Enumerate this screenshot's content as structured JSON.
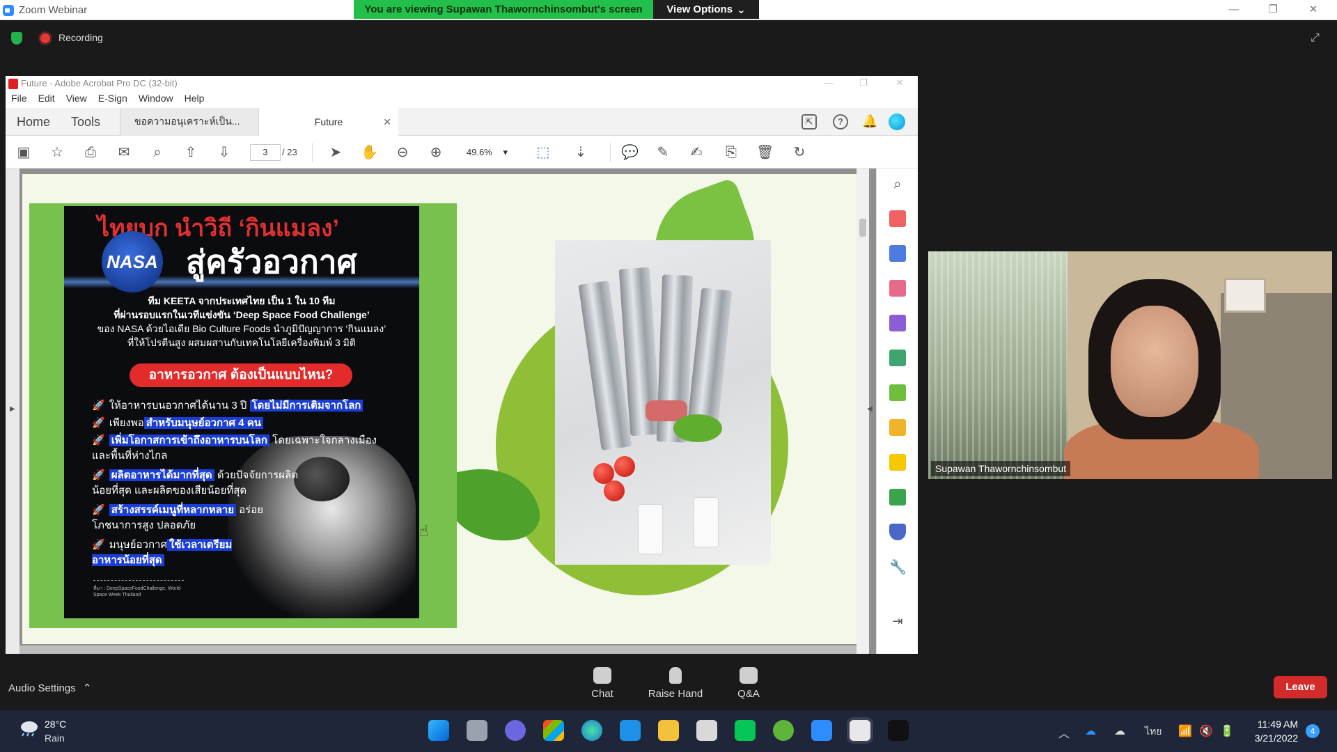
{
  "zoom": {
    "app_title": "Zoom Webinar",
    "share_banner": "You are viewing Supawan Thawornchinsombut's screen",
    "view_options": "View Options",
    "recording_label": "Recording"
  },
  "acrobat": {
    "title": "Future - Adobe Acrobat Pro DC (32-bit)",
    "menu": [
      "File",
      "Edit",
      "View",
      "E-Sign",
      "Window",
      "Help"
    ],
    "tab_home": "Home",
    "tab_tools": "Tools",
    "doc_tabs": [
      "ขอความอนุเคราะห์เป็น...",
      "Future"
    ],
    "page_current": "3",
    "page_total": "/ 23",
    "zoom_level": "49.6%"
  },
  "poster": {
    "headline_1": "ไทยบุก นำวิถี ‘กินแมลง’",
    "nasa": "NASA",
    "headline_2": "สู่ครัวอวกาศ",
    "intro": [
      "ทีม KEETA จากประเทศไทย เป็น 1 ใน 10 ทีม",
      "ที่ผ่านรอบแรกในเวทีแข่งขัน ‘Deep Space Food Challenge’",
      "ของ NASA ด้วยไอเดีย Bio Culture Foods นำภูมิปัญญาการ ‘กินแมลง’",
      "ที่ให้โปรตีนสูง ผสมผสานกับเทคโนโลยีเครื่องพิมพ์ 3 มิติ"
    ],
    "pill": "อาหารอวกาศ ต้องเป็นแบบไหน?",
    "bullets": [
      {
        "pre": "ให้อาหารบนอวกาศได้นาน 3 ปี ",
        "hl": "โดยไม่มีการเติมจากโลก",
        "post": ""
      },
      {
        "pre": "เพียงพอ",
        "hl": "สำหรับมนุษย์อวกาศ 4 คน",
        "post": ""
      },
      {
        "pre": "",
        "hl": "เพิ่มโอกาสการเข้าถึงอาหารบนโลก",
        "post": " โดยเฉพาะใจกลางเมือง และพื้นที่ห่างไกล"
      },
      {
        "pre": "",
        "hl": "ผลิตอาหารได้มากที่สุด",
        "post": " ด้วยปัจจัยการผลิต น้อยที่สุด และผลิตของเสียน้อยที่สุด"
      },
      {
        "pre": "",
        "hl": "สร้างสรรค์เมนูที่หลากหลาย",
        "post": " อร่อย โภชนาการสูง ปลอดภัย"
      },
      {
        "pre": "มนุษย์อวกาศ",
        "hl": "ใช้เวลาเตรียม อาหารน้อยที่สุด",
        "post": ""
      }
    ],
    "footer": "ที่มา : DeepSpaceFoodChallenge, World Space Week Thailand"
  },
  "video": {
    "participant_name": "Supawan Thawornchinsombut"
  },
  "controls": {
    "audio_settings": "Audio Settings",
    "chat": "Chat",
    "raise_hand": "Raise Hand",
    "qa": "Q&A",
    "leave": "Leave"
  },
  "taskbar": {
    "temp": "28°C",
    "weather": "Rain",
    "lang": "ไทย",
    "time": "11:49 AM",
    "date": "3/21/2022",
    "notifications": "4"
  }
}
